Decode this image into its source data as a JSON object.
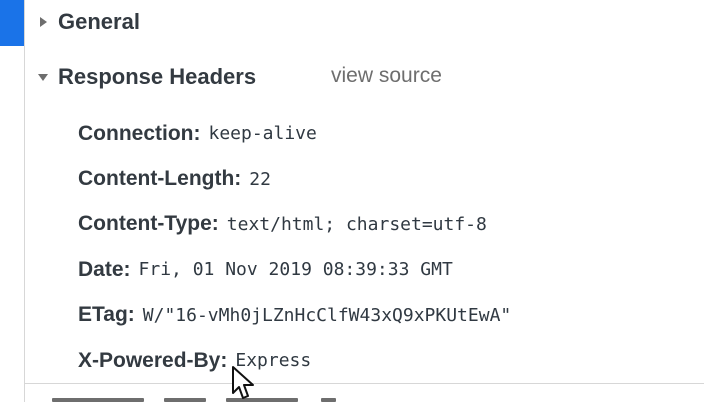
{
  "sections": {
    "general": {
      "title": "General",
      "expanded": false
    },
    "response_headers": {
      "title": "Response Headers",
      "expanded": true,
      "view_source_label": "view source",
      "headers": [
        {
          "name": "Connection:",
          "value": "keep-alive"
        },
        {
          "name": "Content-Length:",
          "value": "22"
        },
        {
          "name": "Content-Type:",
          "value": "text/html; charset=utf-8"
        },
        {
          "name": "Date:",
          "value": "Fri, 01 Nov 2019 08:39:33 GMT"
        },
        {
          "name": "ETag:",
          "value": "W/\"16-vMh0jLZnHcClfW43xQ9xPKUtEwA\""
        },
        {
          "name": "X-Powered-By:",
          "value": "Express"
        }
      ]
    }
  },
  "colors": {
    "selection": "#1a73e8",
    "text": "#333a41",
    "muted": "#6e6e6e",
    "divider": "#d7d7d7"
  },
  "icons": {
    "general_toggle": "triangle-right-icon",
    "response_headers_toggle": "triangle-down-icon",
    "mouse_pointer": "mouse-pointer-icon"
  }
}
